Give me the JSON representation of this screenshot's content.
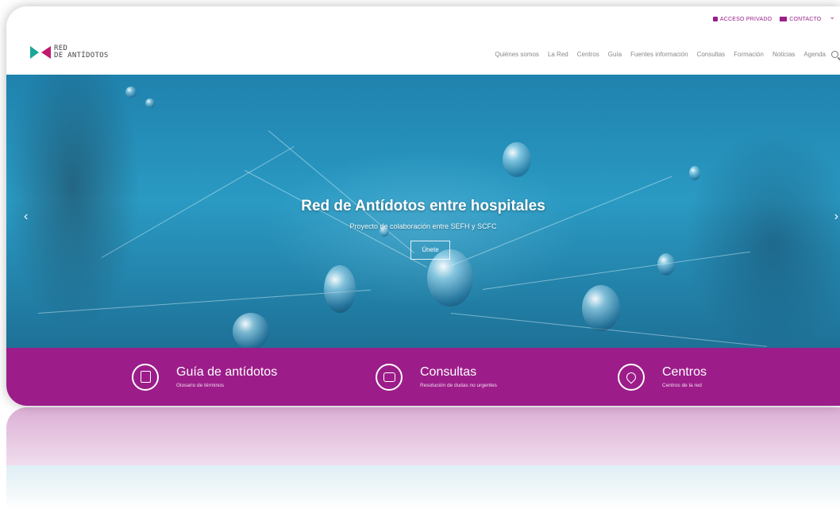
{
  "topbar": {
    "private_access": "ACCESO PRIVADO",
    "contact": "CONTACTO"
  },
  "logo": {
    "line1": "RED",
    "line2": "DE ANTÍDOTOS"
  },
  "nav": [
    "Quiénes somos",
    "La Red",
    "Centros",
    "Guía",
    "Fuentes información",
    "Consultas",
    "Formación",
    "Noticias",
    "Agenda"
  ],
  "hero": {
    "title": "Red de Antídotos entre hospitales",
    "subtitle": "Proyecto de colaboración entre SEFH y SCFC",
    "button": "Únete"
  },
  "features": [
    {
      "title": "Guía de antídotos",
      "subtitle": "Glosario de términos"
    },
    {
      "title": "Consultas",
      "subtitle": "Resolución de dudas no urgentes"
    },
    {
      "title": "Centros",
      "subtitle": "Centros de la red"
    }
  ],
  "colors": {
    "brand_purple": "#9c1d89",
    "logo_teal": "#1aa79a",
    "logo_magenta": "#c2186f"
  }
}
